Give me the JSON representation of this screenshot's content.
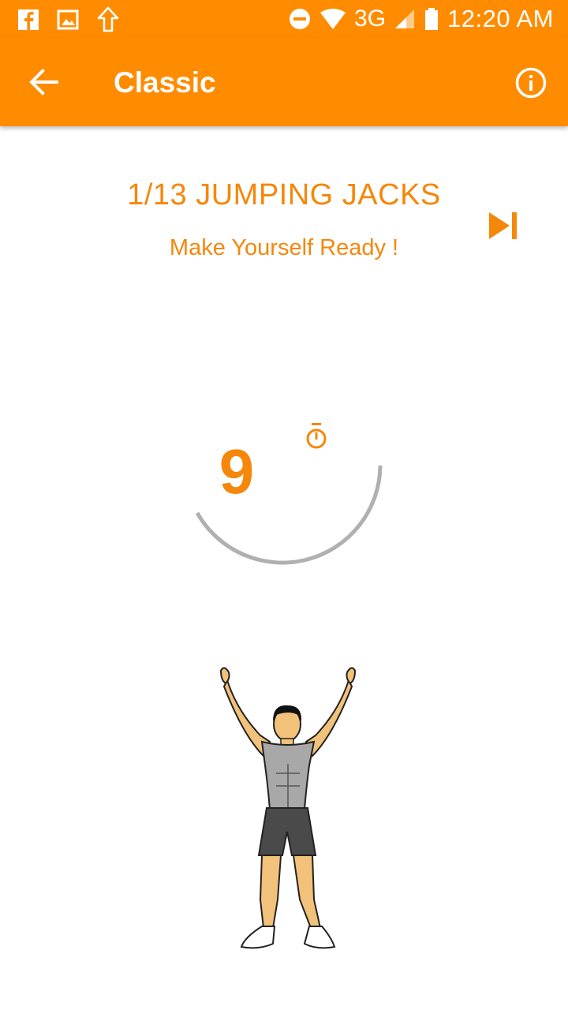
{
  "status_bar": {
    "network": "3G",
    "time": "12:20 AM"
  },
  "app_bar": {
    "title": "Classic"
  },
  "exercise": {
    "progress_title": "1/13 JUMPING JACKS",
    "subtitle": "Make Yourself Ready !",
    "countdown": "9"
  },
  "colors": {
    "accent": "#FF8C00",
    "text_accent": "#F5870A",
    "ring": "#B0B0B0"
  },
  "icons": {
    "back": "arrow-back-icon",
    "info": "info-icon",
    "skip": "skip-next-icon",
    "stopwatch": "stopwatch-icon"
  }
}
